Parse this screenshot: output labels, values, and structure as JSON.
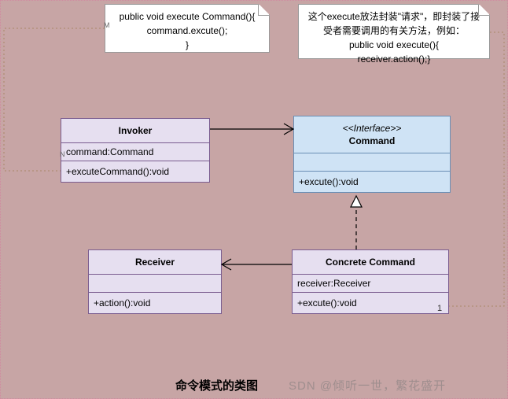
{
  "notes": {
    "left_marker": "M",
    "left_lines": [
      "public void execute Command(){",
      "command.excute();",
      "}"
    ],
    "right_lines": [
      "这个execute放法封装\"请求\"，即封装了接",
      "受者需要调用的有关方法，例如：",
      "public void execute(){",
      "receiver.action();}"
    ]
  },
  "classes": {
    "invoker": {
      "marker": "N",
      "name": "Invoker",
      "attr": "command:Command",
      "op": "+excuteCommand():void"
    },
    "command": {
      "stereo": "<<Interface>>",
      "name": "Command",
      "op": "+excute():void"
    },
    "receiver": {
      "name": "Receiver",
      "op": "+action():void"
    },
    "concrete": {
      "name": "Concrete Command",
      "attr": "receiver:Receiver",
      "op": "+excute():void"
    }
  },
  "edge_labels": {
    "concrete_multiplicity": "1"
  },
  "caption": "命令模式的类图",
  "watermark": "SDN @倾听一世，繁花盛开"
}
